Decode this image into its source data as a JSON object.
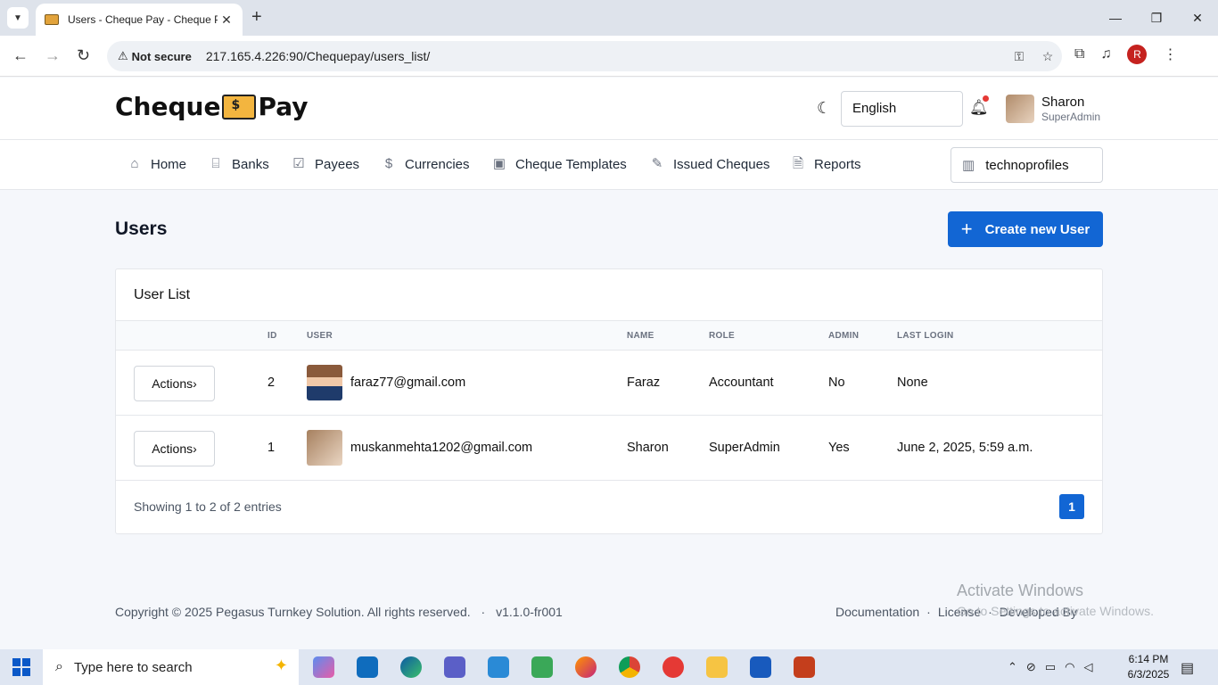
{
  "browser": {
    "tab_title": "Users - Cheque Pay - Cheque P",
    "security_label": "Not secure",
    "url": "217.165.4.226:90/Chequepay/users_list/",
    "profile_initial": "R"
  },
  "header": {
    "logo_left": "Cheque",
    "logo_right": "Pay",
    "language": "English",
    "user_name": "Sharon",
    "user_role": "SuperAdmin"
  },
  "nav": {
    "items": [
      {
        "label": "Home",
        "icon": "home-icon"
      },
      {
        "label": "Banks",
        "icon": "bank-icon"
      },
      {
        "label": "Payees",
        "icon": "payee-icon"
      },
      {
        "label": "Currencies",
        "icon": "dollar-icon"
      },
      {
        "label": "Cheque Templates",
        "icon": "template-icon"
      },
      {
        "label": "Issued Cheques",
        "icon": "pen-icon"
      },
      {
        "label": "Reports",
        "icon": "report-icon"
      }
    ],
    "tenant": "technoprofiles"
  },
  "page": {
    "title": "Users",
    "create_button": "Create new User"
  },
  "user_list": {
    "title": "User List",
    "columns": [
      "ID",
      "USER",
      "NAME",
      "ROLE",
      "ADMIN",
      "LAST LOGIN"
    ],
    "action_label": "Actions",
    "rows": [
      {
        "id": "2",
        "user": "faraz77@gmail.com",
        "name": "Faraz",
        "role": "Accountant",
        "admin": "No",
        "last_login": "None"
      },
      {
        "id": "1",
        "user": "muskanmehta1202@gmail.com",
        "name": "Sharon",
        "role": "SuperAdmin",
        "admin": "Yes",
        "last_login": "June 2, 2025, 5:59 a.m."
      }
    ],
    "showing": "Showing 1 to 2 of 2 entries",
    "current_page": "1"
  },
  "footer": {
    "copyright": "Copyright © 2025 Pegasus Turnkey Solution. All rights reserved.",
    "version": "v1.1.0-fr001",
    "links": [
      "Documentation",
      "License",
      "Developed By"
    ]
  },
  "watermark": {
    "title": "Activate Windows",
    "subtitle": "Go to Settings to activate Windows."
  },
  "taskbar": {
    "search_placeholder": "Type here to search",
    "time": "6:14 PM",
    "date": "6/3/2025"
  }
}
